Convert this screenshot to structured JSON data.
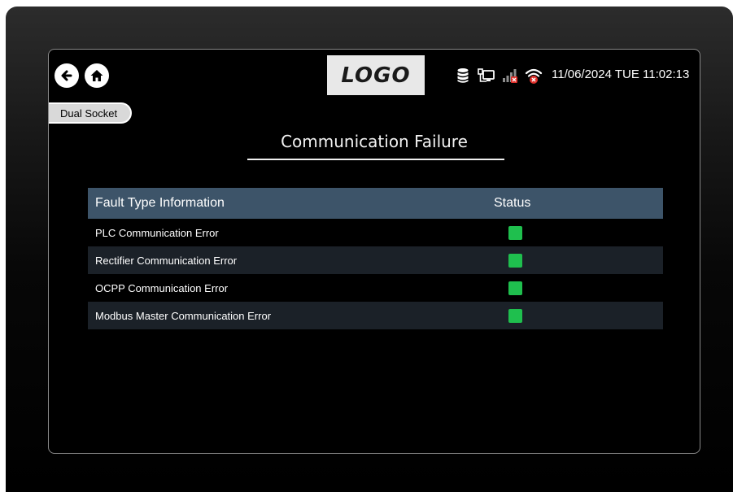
{
  "header": {
    "logo_text": "LOGO",
    "datetime": "11/06/2024 TUE 11:02:13",
    "icons": [
      "back-arrow-icon",
      "home-icon",
      "database-icon",
      "network-monitor-icon",
      "signal-bars-error-icon",
      "wifi-error-icon"
    ]
  },
  "mode_tab": {
    "label": "Dual Socket"
  },
  "page": {
    "title": "Communication Failure"
  },
  "fault_table": {
    "columns": [
      "Fault Type Information",
      "Status"
    ],
    "rows": [
      {
        "fault": "PLC Communication Error",
        "status": "ok"
      },
      {
        "fault": "Rectifier Communication Error",
        "status": "ok"
      },
      {
        "fault": "OCPP Communication Error",
        "status": "ok"
      },
      {
        "fault": "Modbus Master Communication Error",
        "status": "ok"
      }
    ]
  },
  "colors": {
    "header_row": "#3d5469",
    "stripe_row": "#1b2128",
    "status_ok": "#1fbf4e",
    "error_badge": "#e0302b"
  }
}
